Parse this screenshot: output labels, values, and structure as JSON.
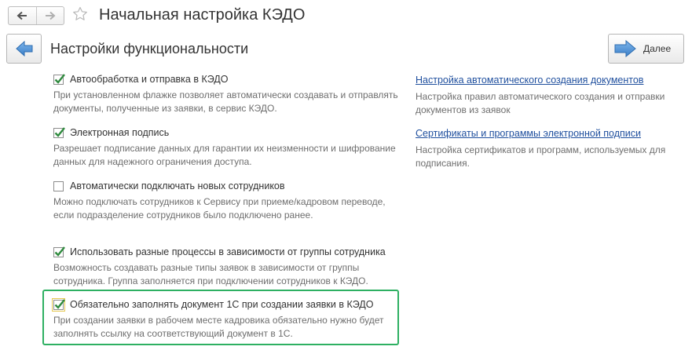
{
  "header": {
    "title": "Начальная настройка КЭДО",
    "back_icon": "arrow-left-icon",
    "forward_icon": "arrow-right-icon",
    "favorite_icon": "star-icon"
  },
  "toolbar": {
    "page_title": "Настройки функциональности",
    "next_label": "Далее"
  },
  "options": [
    {
      "label": "Автообработка и отправка в КЭДО",
      "checked": true,
      "description": "При установленном флажке позволяет автоматически создавать и отправлять документы, полученные из заявки, в сервис КЭДО."
    },
    {
      "label": "Электронная подпись",
      "checked": true,
      "description": "Разрешает подписание данных для гарантии их неизменности и шифрование данных для надежного ограничения доступа."
    },
    {
      "label": "Автоматически подключать новых сотрудников",
      "checked": false,
      "description": "Можно подключать сотрудников к Сервису при приеме/кадровом переводе, если подразделение сотрудников было подключено ранее."
    },
    {
      "label": "Использовать разные процессы в зависимости от группы сотрудника",
      "checked": true,
      "description": "Возможность создавать разные типы заявок в зависимости от группы сотрудника. Группа заполняется при подключении сотрудников к КЭДО."
    },
    {
      "label": "Обязательно заполнять документ 1С при создании заявки в КЭДО",
      "checked": true,
      "description": "При создании заявки в рабочем месте кадровика обязательно нужно будет заполнять ссылку на соответствующий документ в 1С."
    }
  ],
  "links": [
    {
      "label": "Настройка автоматического создания документов",
      "description": "Настройка правил автоматического создания и отправки документов из заявок"
    },
    {
      "label": "Сертификаты и программы электронной подписи",
      "description": "Настройка сертификатов и программ, используемых для подписания."
    }
  ],
  "colors": {
    "highlight": "#2eb062",
    "link": "#1f4f9e",
    "checkmark": "#2f8a3e",
    "nav_arrow": "#4a90d9"
  }
}
